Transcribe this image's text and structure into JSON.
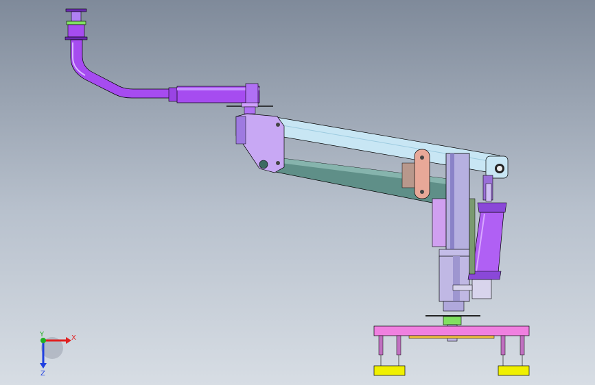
{
  "viewport": {
    "background_top": "#7f8a9a",
    "background_bottom": "#d7dde4"
  },
  "triad": {
    "x_label": "X",
    "y_label": "Y",
    "z_label": "Z",
    "x_color": "#e02020",
    "y_color": "#20b020",
    "z_color": "#2040e0"
  },
  "colors": {
    "arm_purple": "#a64cf0",
    "arm_purple_dark": "#7a2fc0",
    "cyan_beam": "#c8e6f4",
    "teal_beam": "#5f8f88",
    "column": "#b6b0e0",
    "column_dark": "#8a82c8",
    "bracket": "#c8a8f4",
    "base_pink": "#f080e0",
    "foot_yellow": "#f0f000",
    "link_salmon": "#e8a898",
    "cylinder_purple": "#b060f4"
  }
}
